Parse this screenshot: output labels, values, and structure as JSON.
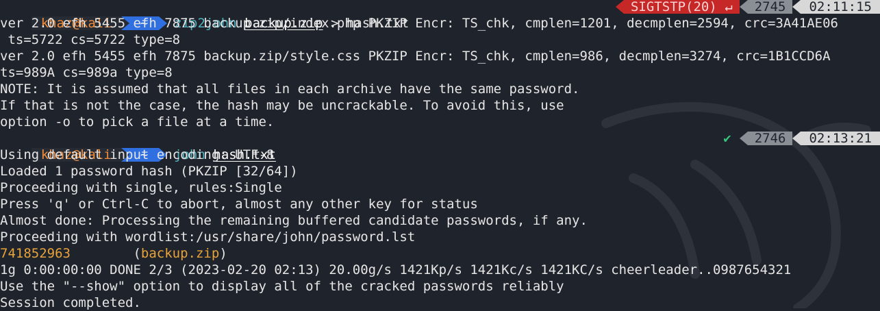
{
  "prompt1": {
    "user": "khaz@kali",
    "dir": "~",
    "command": "zip2john",
    "arg": "backup.zip",
    "redirect": " > hash.txt",
    "signal": "SIGTSTP(20)",
    "signal_icon": "↵",
    "history_num": "2745",
    "time": "02:11:15"
  },
  "output1": [
    "ver 2.0 efh 5455 efh 7875 backup.zip/index.php PKZIP Encr: TS_chk, cmplen=1201, decmplen=2594, crc=3A41AE06",
    " ts=5722 cs=5722 type=8",
    "ver 2.0 efh 5455 efh 7875 backup.zip/style.css PKZIP Encr: TS_chk, cmplen=986, decmplen=3274, crc=1B1CCD6A",
    "ts=989A cs=989a type=8",
    "NOTE: It is assumed that all files in each archive have the same password.",
    "If that is not the case, the hash may be uncrackable. To avoid this, use",
    "option -o to pick a file at a time."
  ],
  "prompt2": {
    "user": "khaz@kali",
    "dir": "~",
    "command": "john",
    "arg": "hash.txt",
    "status": "✔",
    "history_num": "2746",
    "time": "02:13:21"
  },
  "output2": [
    "Using default input encoding: UTF-8",
    "Loaded 1 password hash (PKZIP [32/64])",
    "Proceeding with single, rules:Single",
    "Press 'q' or Ctrl-C to abort, almost any other key for status",
    "Almost done: Processing the remaining buffered candidate passwords, if any.",
    "Proceeding with wordlist:/usr/share/john/password.lst"
  ],
  "cracked": {
    "password": "741852963",
    "gap": "        ",
    "open": "(",
    "file": "backup.zip",
    "close": ")"
  },
  "output3": [
    "1g 0:00:00:00 DONE 2/3 (2023-02-20 02:13) 20.00g/s 1421Kp/s 1421Kc/s 1421KC/s cheerleader..0987654321",
    "Use the \"--show\" option to display all of the cracked passwords reliably",
    "Session completed."
  ],
  "colors": {
    "background": "#1f232b",
    "user": "#f08c3a",
    "dir_segment": "#2f6fe0",
    "command": "#4fb3bf",
    "error": "#c62828",
    "ok": "#36c37a",
    "highlight": "#e8a33a"
  }
}
